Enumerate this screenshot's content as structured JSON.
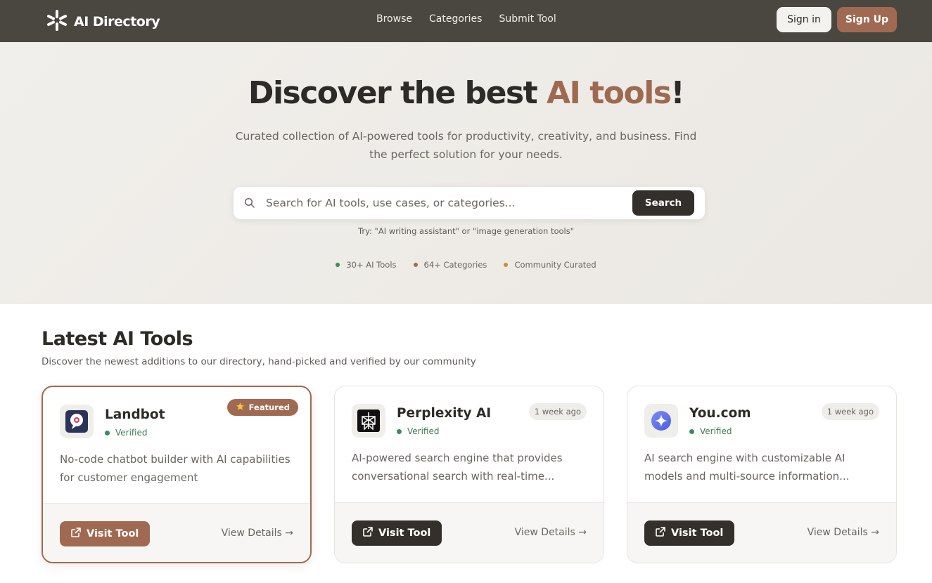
{
  "nav": {
    "logo_text": "AI Directory",
    "links": [
      "Browse",
      "Categories",
      "Submit Tool"
    ],
    "signin_label": "Sign in",
    "signup_label": "Sign Up"
  },
  "hero": {
    "title_before": "Discover the best ",
    "title_accent": "AI tools",
    "title_after": "!",
    "subtitle": "Curated collection of AI-powered tools for productivity, creativity, and business. Find the perfect solution for your needs.",
    "search_placeholder": "Search for AI tools, use cases, or categories...",
    "search_button": "Search",
    "hint": "Try: \"AI writing assistant\" or \"image generation tools\"",
    "stats": [
      {
        "label": "30+ AI Tools",
        "color": "#3d8a5c"
      },
      {
        "label": "64+ Categories",
        "color": "#a06a52"
      },
      {
        "label": "Community Curated",
        "color": "#d08a2a"
      }
    ]
  },
  "section": {
    "title": "Latest AI Tools",
    "subtitle": "Discover the newest additions to our directory, hand-picked and verified by our community"
  },
  "cards": [
    {
      "name": "Landbot",
      "verified": "Verified",
      "badge": "Featured",
      "description": "No-code chatbot builder with AI capabilities for customer engagement",
      "visit_label": "Visit Tool",
      "details_label": "View Details →"
    },
    {
      "name": "Perplexity AI",
      "verified": "Verified",
      "badge": "1 week ago",
      "description": "AI-powered search engine that provides conversational search with real-time...",
      "visit_label": "Visit Tool",
      "details_label": "View Details →"
    },
    {
      "name": "You.com",
      "verified": "Verified",
      "badge": "1 week ago",
      "description": "AI search engine with customizable AI models and multi-source information...",
      "visit_label": "Visit Tool",
      "details_label": "View Details →"
    }
  ],
  "colors": {
    "nav_bg": "#4a4640",
    "accent": "#9d6a51",
    "dark_button": "#33302b"
  }
}
